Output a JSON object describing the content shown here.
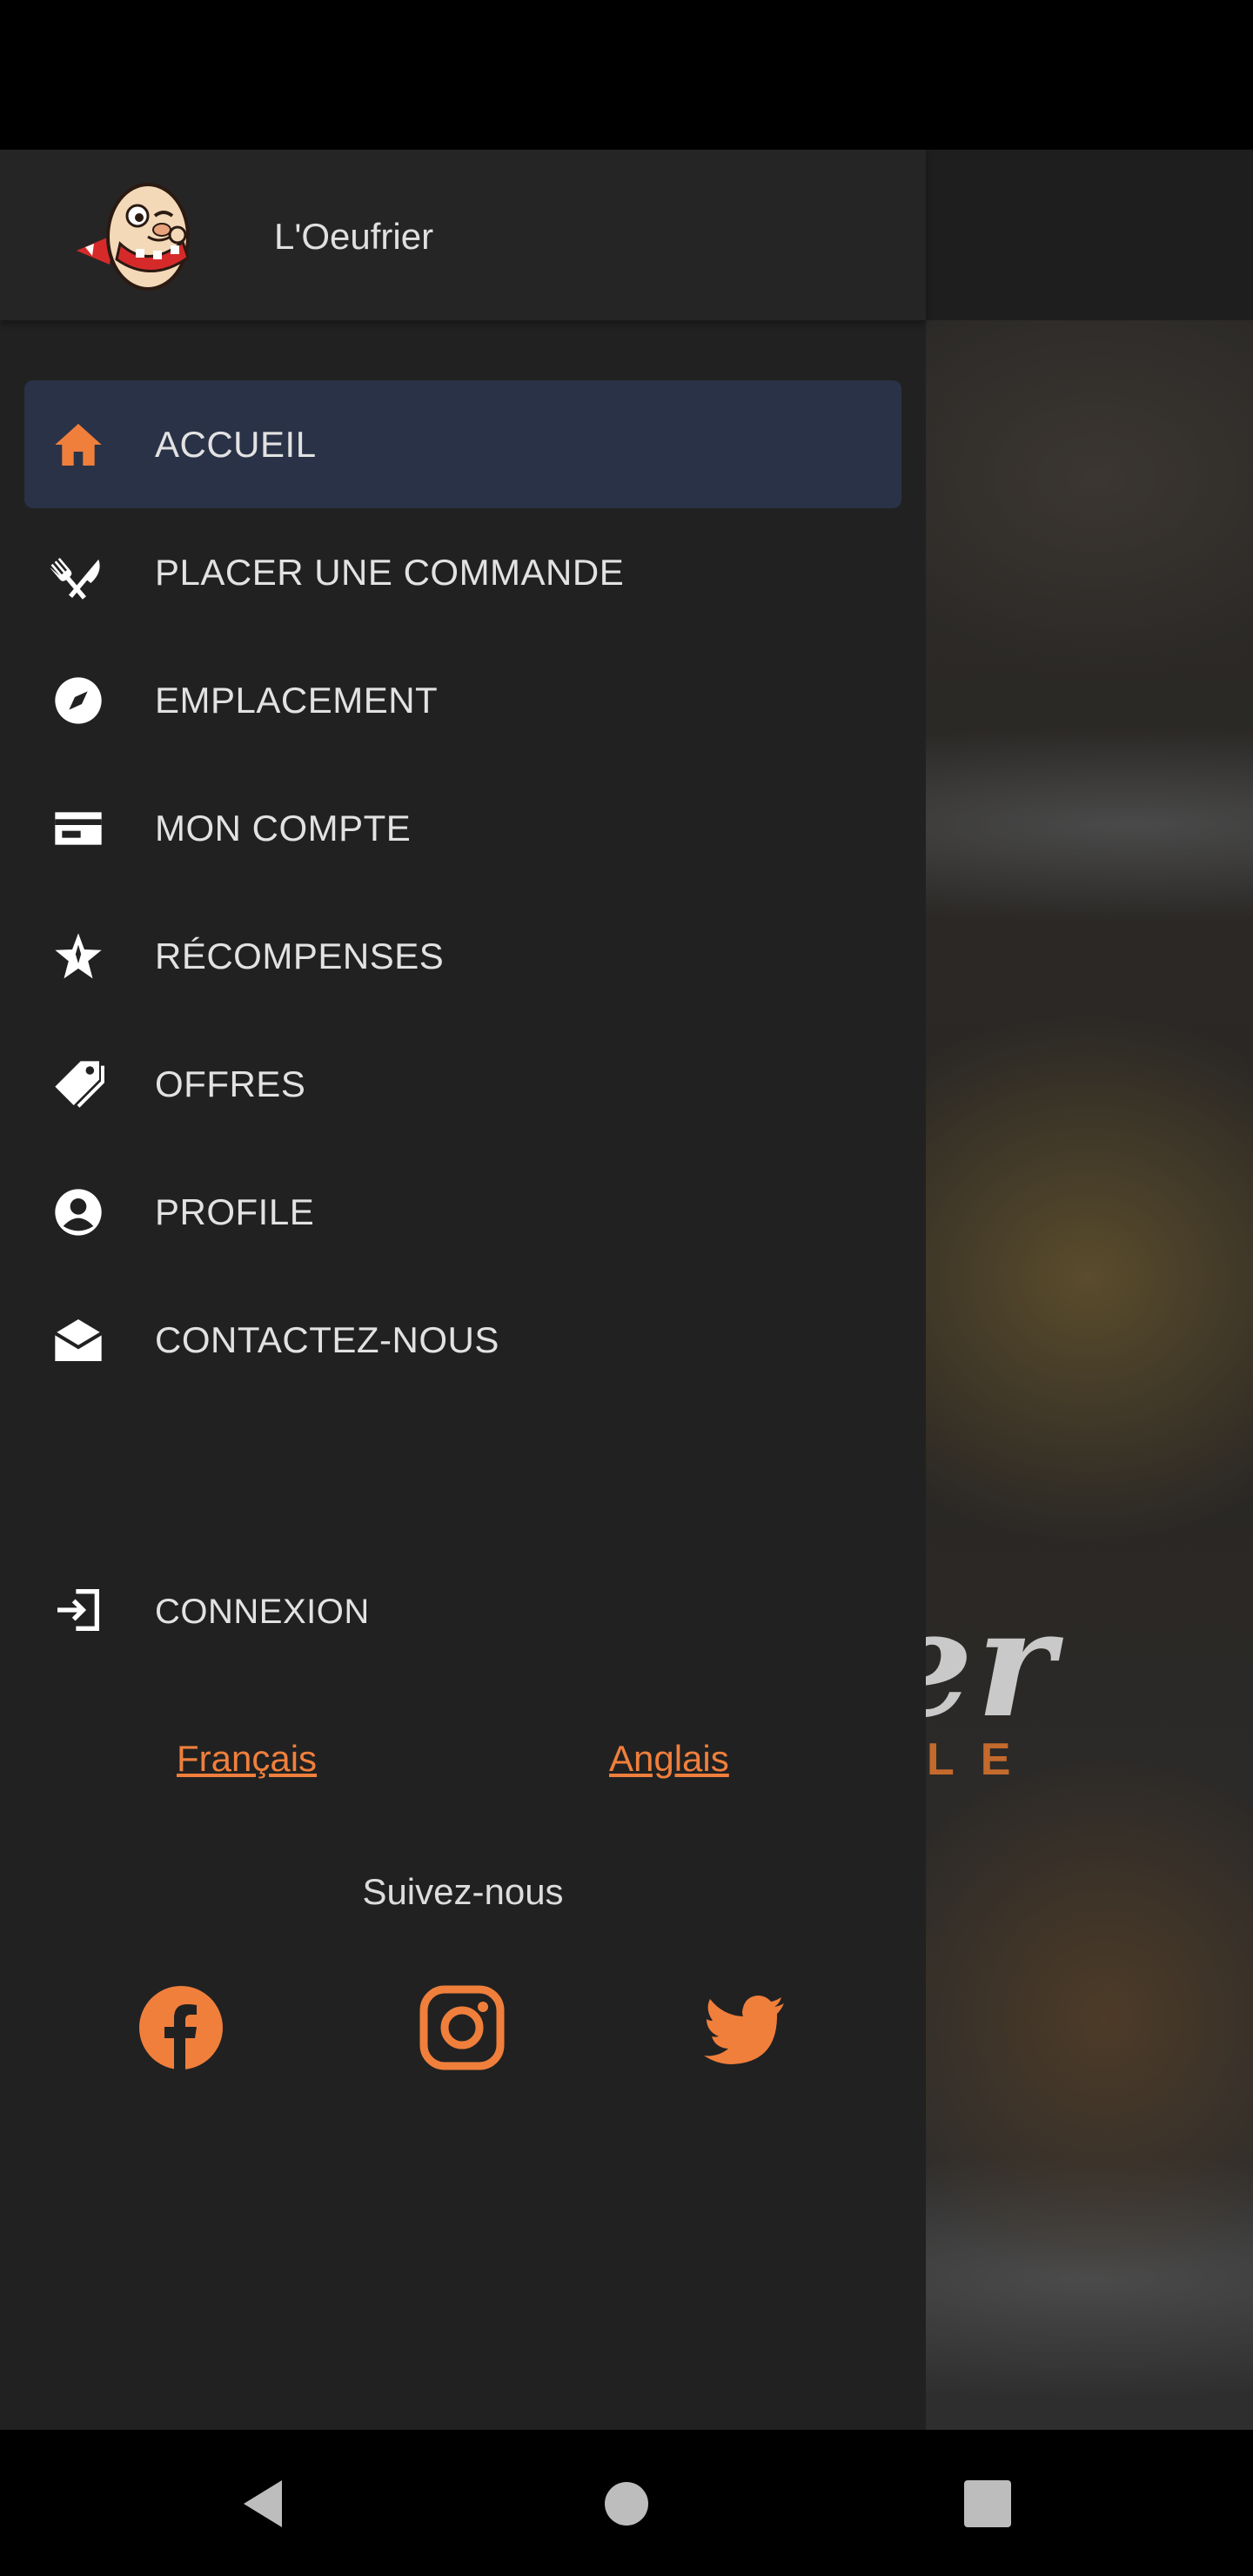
{
  "app": {
    "name": "L'Oeufrier"
  },
  "background": {
    "logo_text": "er",
    "logo_sub": "LE"
  },
  "menu": {
    "items": [
      {
        "label": "ACCUEIL",
        "icon": "home-icon",
        "active": true
      },
      {
        "label": "PLACER UNE COMMANDE",
        "icon": "utensils-icon",
        "active": false
      },
      {
        "label": "EMPLACEMENT",
        "icon": "compass-icon",
        "active": false
      },
      {
        "label": "MON COMPTE",
        "icon": "card-icon",
        "active": false
      },
      {
        "label": "RÉCOMPENSES",
        "icon": "star-icon",
        "active": false
      },
      {
        "label": "OFFRES",
        "icon": "tags-icon",
        "active": false
      },
      {
        "label": "PROFILE",
        "icon": "user-circle-icon",
        "active": false
      },
      {
        "label": "CONTACTEZ-NOUS",
        "icon": "envelope-open-icon",
        "active": false
      }
    ],
    "login_label": "CONNEXION",
    "login_icon": "sign-in-icon"
  },
  "languages": {
    "french": "Français",
    "english": "Anglais"
  },
  "social": {
    "title": "Suivez-nous",
    "networks": [
      "facebook-icon",
      "instagram-icon",
      "twitter-icon"
    ]
  },
  "colors": {
    "accent": "#f07f3c",
    "drawer_bg": "#212121",
    "active_bg": "#2a3247",
    "text": "#e2e2e2"
  }
}
